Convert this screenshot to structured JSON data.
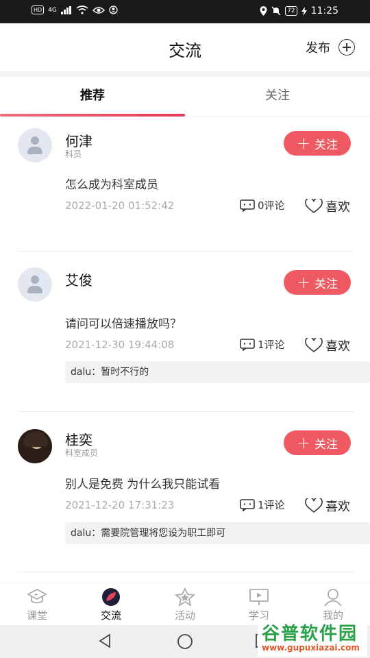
{
  "status_bar": {
    "hd": "HD",
    "signal": "4G",
    "battery": "72",
    "time": "11:25"
  },
  "header": {
    "title": "交流",
    "publish_label": "发布"
  },
  "tabs": [
    {
      "label": "推荐",
      "active": true
    },
    {
      "label": "关注",
      "active": false
    }
  ],
  "posts": [
    {
      "name": "何津",
      "role": "科员",
      "follow_label": "关注",
      "content": "怎么成为科室成员",
      "time": "2022-01-20 01:52:42",
      "comments": "0评论",
      "like_label": "喜欢",
      "reply": ""
    },
    {
      "name": "艾俊",
      "role": "",
      "follow_label": "关注",
      "content": "请问可以倍速播放吗？",
      "time": "2021-12-30 19:44:08",
      "comments": "1评论",
      "like_label": "喜欢",
      "reply": "dalu：暂时不行的"
    },
    {
      "name": "桂奕",
      "role": "科室成员",
      "follow_label": "关注",
      "content": "别人是免费  为什么我只能试看",
      "time": "2021-12-20 17:31:23",
      "comments": "1评论",
      "like_label": "喜欢",
      "reply": "dalu：需要院管理将您设为职工即可"
    }
  ],
  "tabbar": [
    {
      "label": "课堂",
      "icon": "classroom-icon",
      "active": false
    },
    {
      "label": "交流",
      "icon": "chat-leaf-icon",
      "active": true
    },
    {
      "label": "活动",
      "icon": "star-badge-icon",
      "active": false
    },
    {
      "label": "学习",
      "icon": "video-board-icon",
      "active": false
    },
    {
      "label": "我的",
      "icon": "profile-icon",
      "active": false
    }
  ],
  "watermark": {
    "main": "谷普软件园",
    "sub": "www.gupuxiazai.com"
  },
  "colors": {
    "accent": "#ef5a62",
    "tab_underline": "#e23b5a",
    "watermark_green": "#2aa148"
  }
}
